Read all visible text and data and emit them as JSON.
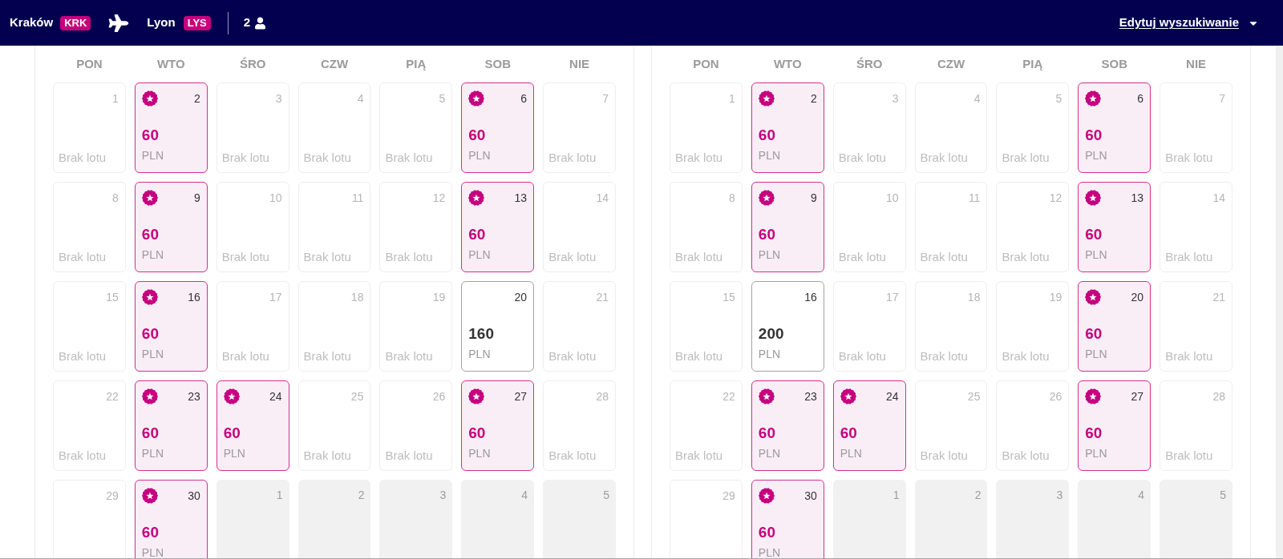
{
  "header": {
    "origin": {
      "city": "Kraków",
      "code": "KRK"
    },
    "destination": {
      "city": "Lyon",
      "code": "LYS"
    },
    "passengers": "2",
    "edit_link": "Edytuj wyszukiwanie"
  },
  "calendars": [
    {
      "weekdays": [
        "PON",
        "WTO",
        "ŚRO",
        "CZW",
        "PIĄ",
        "SOB",
        "NIE"
      ],
      "days": [
        {
          "day": "1",
          "kind": "no_flight",
          "note": "Brak lotu"
        },
        {
          "day": "2",
          "kind": "fare",
          "featured": true,
          "price": "60",
          "currency": "PLN"
        },
        {
          "day": "3",
          "kind": "no_flight",
          "note": "Brak lotu"
        },
        {
          "day": "4",
          "kind": "no_flight",
          "note": "Brak lotu"
        },
        {
          "day": "5",
          "kind": "no_flight",
          "note": "Brak lotu"
        },
        {
          "day": "6",
          "kind": "fare",
          "featured": true,
          "price": "60",
          "currency": "PLN"
        },
        {
          "day": "7",
          "kind": "no_flight",
          "note": "Brak lotu"
        },
        {
          "day": "8",
          "kind": "no_flight",
          "note": "Brak lotu"
        },
        {
          "day": "9",
          "kind": "fare",
          "featured": true,
          "price": "60",
          "currency": "PLN"
        },
        {
          "day": "10",
          "kind": "no_flight",
          "note": "Brak lotu"
        },
        {
          "day": "11",
          "kind": "no_flight",
          "note": "Brak lotu"
        },
        {
          "day": "12",
          "kind": "no_flight",
          "note": "Brak lotu"
        },
        {
          "day": "13",
          "kind": "fare",
          "featured": true,
          "price": "60",
          "currency": "PLN"
        },
        {
          "day": "14",
          "kind": "no_flight",
          "note": "Brak lotu"
        },
        {
          "day": "15",
          "kind": "no_flight",
          "note": "Brak lotu"
        },
        {
          "day": "16",
          "kind": "fare",
          "featured": true,
          "price": "60",
          "currency": "PLN"
        },
        {
          "day": "17",
          "kind": "no_flight",
          "note": "Brak lotu"
        },
        {
          "day": "18",
          "kind": "no_flight",
          "note": "Brak lotu"
        },
        {
          "day": "19",
          "kind": "no_flight",
          "note": "Brak lotu"
        },
        {
          "day": "20",
          "kind": "fare",
          "featured": false,
          "price": "160",
          "currency": "PLN"
        },
        {
          "day": "21",
          "kind": "no_flight",
          "note": "Brak lotu"
        },
        {
          "day": "22",
          "kind": "no_flight",
          "note": "Brak lotu"
        },
        {
          "day": "23",
          "kind": "fare",
          "featured": true,
          "price": "60",
          "currency": "PLN"
        },
        {
          "day": "24",
          "kind": "fare",
          "featured": true,
          "price": "60",
          "currency": "PLN"
        },
        {
          "day": "25",
          "kind": "no_flight",
          "note": "Brak lotu"
        },
        {
          "day": "26",
          "kind": "no_flight",
          "note": "Brak lotu"
        },
        {
          "day": "27",
          "kind": "fare",
          "featured": true,
          "price": "60",
          "currency": "PLN"
        },
        {
          "day": "28",
          "kind": "no_flight",
          "note": "Brak lotu"
        },
        {
          "day": "29",
          "kind": "no_flight"
        },
        {
          "day": "30",
          "kind": "fare",
          "featured": true,
          "price": "60",
          "currency": "PLN"
        },
        {
          "day": "1",
          "kind": "outside"
        },
        {
          "day": "2",
          "kind": "outside"
        },
        {
          "day": "3",
          "kind": "outside"
        },
        {
          "day": "4",
          "kind": "outside"
        },
        {
          "day": "5",
          "kind": "outside"
        }
      ]
    },
    {
      "weekdays": [
        "PON",
        "WTO",
        "ŚRO",
        "CZW",
        "PIĄ",
        "SOB",
        "NIE"
      ],
      "days": [
        {
          "day": "1",
          "kind": "no_flight",
          "note": "Brak lotu"
        },
        {
          "day": "2",
          "kind": "fare",
          "featured": true,
          "price": "60",
          "currency": "PLN"
        },
        {
          "day": "3",
          "kind": "no_flight",
          "note": "Brak lotu"
        },
        {
          "day": "4",
          "kind": "no_flight",
          "note": "Brak lotu"
        },
        {
          "day": "5",
          "kind": "no_flight",
          "note": "Brak lotu"
        },
        {
          "day": "6",
          "kind": "fare",
          "featured": true,
          "price": "60",
          "currency": "PLN"
        },
        {
          "day": "7",
          "kind": "no_flight",
          "note": "Brak lotu"
        },
        {
          "day": "8",
          "kind": "no_flight",
          "note": "Brak lotu"
        },
        {
          "day": "9",
          "kind": "fare",
          "featured": true,
          "price": "60",
          "currency": "PLN"
        },
        {
          "day": "10",
          "kind": "no_flight",
          "note": "Brak lotu"
        },
        {
          "day": "11",
          "kind": "no_flight",
          "note": "Brak lotu"
        },
        {
          "day": "12",
          "kind": "no_flight",
          "note": "Brak lotu"
        },
        {
          "day": "13",
          "kind": "fare",
          "featured": true,
          "price": "60",
          "currency": "PLN"
        },
        {
          "day": "14",
          "kind": "no_flight",
          "note": "Brak lotu"
        },
        {
          "day": "15",
          "kind": "no_flight",
          "note": "Brak lotu"
        },
        {
          "day": "16",
          "kind": "fare",
          "featured": false,
          "price": "200",
          "currency": "PLN"
        },
        {
          "day": "17",
          "kind": "no_flight",
          "note": "Brak lotu"
        },
        {
          "day": "18",
          "kind": "no_flight",
          "note": "Brak lotu"
        },
        {
          "day": "19",
          "kind": "no_flight",
          "note": "Brak lotu"
        },
        {
          "day": "20",
          "kind": "fare",
          "featured": true,
          "price": "60",
          "currency": "PLN"
        },
        {
          "day": "21",
          "kind": "no_flight",
          "note": "Brak lotu"
        },
        {
          "day": "22",
          "kind": "no_flight",
          "note": "Brak lotu"
        },
        {
          "day": "23",
          "kind": "fare",
          "featured": true,
          "price": "60",
          "currency": "PLN"
        },
        {
          "day": "24",
          "kind": "fare",
          "featured": true,
          "price": "60",
          "currency": "PLN"
        },
        {
          "day": "25",
          "kind": "no_flight",
          "note": "Brak lotu"
        },
        {
          "day": "26",
          "kind": "no_flight",
          "note": "Brak lotu"
        },
        {
          "day": "27",
          "kind": "fare",
          "featured": true,
          "price": "60",
          "currency": "PLN"
        },
        {
          "day": "28",
          "kind": "no_flight",
          "note": "Brak lotu"
        },
        {
          "day": "29",
          "kind": "no_flight"
        },
        {
          "day": "30",
          "kind": "fare",
          "featured": true,
          "price": "60",
          "currency": "PLN"
        },
        {
          "day": "1",
          "kind": "outside"
        },
        {
          "day": "2",
          "kind": "outside"
        },
        {
          "day": "3",
          "kind": "outside"
        },
        {
          "day": "4",
          "kind": "outside"
        },
        {
          "day": "5",
          "kind": "outside"
        }
      ]
    }
  ]
}
